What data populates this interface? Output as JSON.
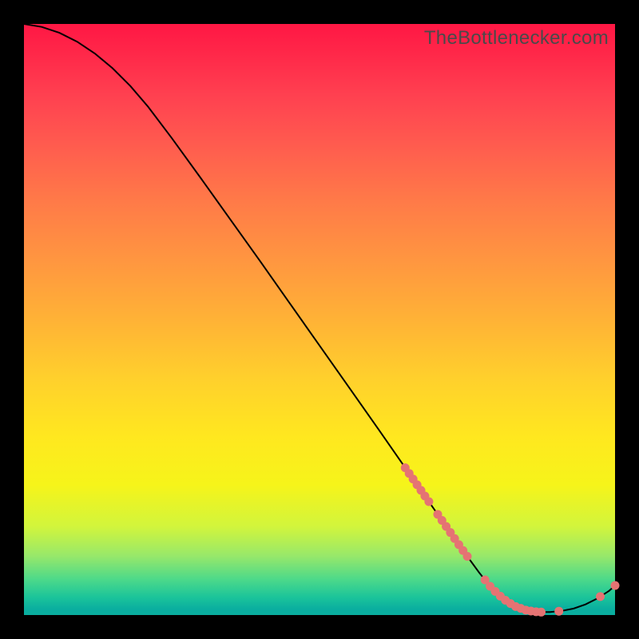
{
  "watermark": "TheBottlenecker.com",
  "chart_data": {
    "type": "line",
    "title": "",
    "xlabel": "",
    "ylabel": "",
    "xlim": [
      0,
      100
    ],
    "ylim": [
      0,
      100
    ],
    "curve": [
      {
        "x": 0,
        "y": 100
      },
      {
        "x": 3,
        "y": 99.5
      },
      {
        "x": 6,
        "y": 98.5
      },
      {
        "x": 9,
        "y": 97.0
      },
      {
        "x": 12,
        "y": 95.0
      },
      {
        "x": 15,
        "y": 92.5
      },
      {
        "x": 18,
        "y": 89.5
      },
      {
        "x": 21,
        "y": 86.0
      },
      {
        "x": 25,
        "y": 80.7
      },
      {
        "x": 30,
        "y": 73.8
      },
      {
        "x": 35,
        "y": 66.8
      },
      {
        "x": 40,
        "y": 59.8
      },
      {
        "x": 45,
        "y": 52.7
      },
      {
        "x": 50,
        "y": 45.6
      },
      {
        "x": 55,
        "y": 38.5
      },
      {
        "x": 60,
        "y": 31.4
      },
      {
        "x": 65,
        "y": 24.2
      },
      {
        "x": 68,
        "y": 19.9
      },
      {
        "x": 71,
        "y": 15.6
      },
      {
        "x": 74,
        "y": 11.3
      },
      {
        "x": 77,
        "y": 7.2
      },
      {
        "x": 79,
        "y": 4.7
      },
      {
        "x": 81,
        "y": 2.8
      },
      {
        "x": 83,
        "y": 1.5
      },
      {
        "x": 85,
        "y": 0.8
      },
      {
        "x": 87,
        "y": 0.5
      },
      {
        "x": 89,
        "y": 0.5
      },
      {
        "x": 91,
        "y": 0.7
      },
      {
        "x": 93,
        "y": 1.1
      },
      {
        "x": 95,
        "y": 1.8
      },
      {
        "x": 97,
        "y": 2.8
      },
      {
        "x": 99,
        "y": 4.1
      },
      {
        "x": 100,
        "y": 5.0
      }
    ],
    "marker_clusters": [
      {
        "x0": 64.5,
        "x1": 68.5,
        "n": 7
      },
      {
        "x0": 70.0,
        "x1": 75.0,
        "n": 8
      },
      {
        "x0": 78.0,
        "x1": 87.5,
        "n": 12
      },
      {
        "x0": 90.0,
        "x1": 91.0,
        "n": 1
      },
      {
        "x0": 97.5,
        "x1": 100.0,
        "n": 2
      }
    ],
    "marker_radius": 5.5
  }
}
